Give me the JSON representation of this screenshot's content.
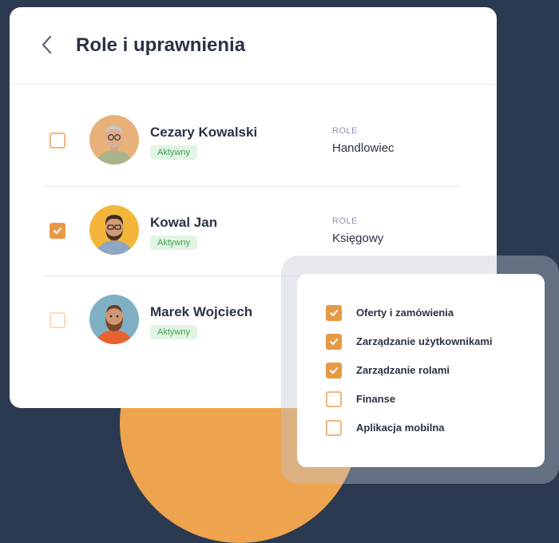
{
  "header": {
    "title": "Role i uprawnienia"
  },
  "users": [
    {
      "name": "Cezary Kowalski",
      "status": "Aktywny",
      "role_label": "ROLE",
      "role": "Handlowiec",
      "checked": false
    },
    {
      "name": "Kowal Jan",
      "status": "Aktywny",
      "role_label": "ROLE",
      "role": "Księgowy",
      "checked": true
    },
    {
      "name": "Marek Wojciech",
      "status": "Aktywny",
      "checked": false
    }
  ],
  "permissions": [
    {
      "label": "Oferty i zamówienia",
      "checked": true
    },
    {
      "label": "Zarządzanie użytkownikami",
      "checked": true
    },
    {
      "label": "Zarządzanie rolami",
      "checked": true
    },
    {
      "label": "Finanse",
      "checked": false
    },
    {
      "label": "Aplikacja mobilna",
      "checked": false
    }
  ],
  "colors": {
    "background": "#2b3a50",
    "accent": "#e69a45",
    "badge_bg": "#e2f5e4",
    "badge_text": "#3f9b54"
  }
}
